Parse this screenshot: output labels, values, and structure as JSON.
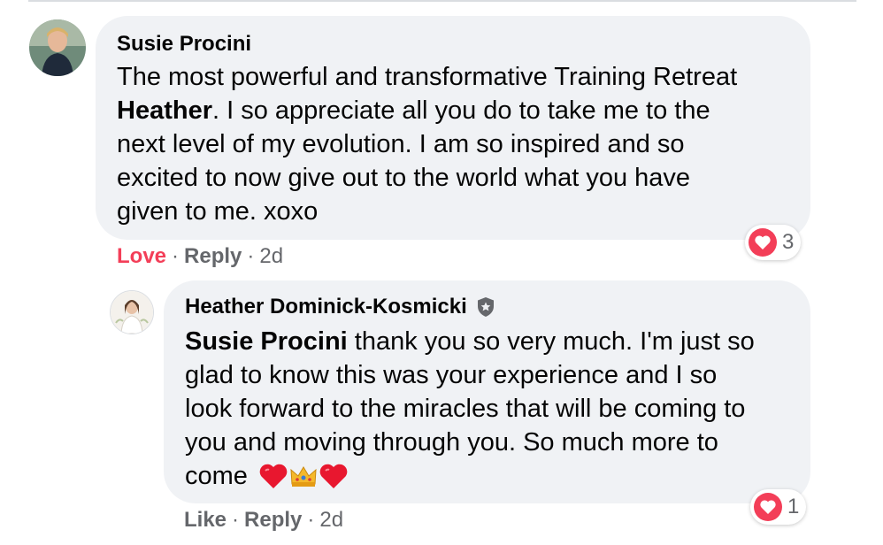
{
  "comment": {
    "author": "Susie Procini",
    "text_lines": [
      "The most powerful and transformative Training Retreat",
      "Heather",
      ". I so appreciate all you do to take me to the",
      "next level of my evolution. I am so inspired and so",
      "excited to now give out to the world what you have",
      "given to me. xoxo"
    ],
    "reaction_count": "3",
    "actions": {
      "love": "Love",
      "reply": "Reply",
      "time": "2d"
    }
  },
  "reply": {
    "author": "Heather Dominick-Kosmicki",
    "mention": "Susie Procini",
    "text_lines": [
      " thank you so very much. I'm just so",
      "glad to know this was your experience and I so",
      "look forward to the miracles that will be coming to",
      "you and moving through you. So much more to",
      "come"
    ],
    "emojis": [
      "heart-emoji",
      "crown-emoji",
      "heart-emoji"
    ],
    "reaction_count": "1",
    "actions": {
      "like": "Like",
      "reply": "Reply",
      "time": "2d"
    }
  },
  "colors": {
    "bubble": "#f0f2f5",
    "secondary_text": "#65676b",
    "love_red": "#f33e58",
    "divider": "#dadde1"
  }
}
